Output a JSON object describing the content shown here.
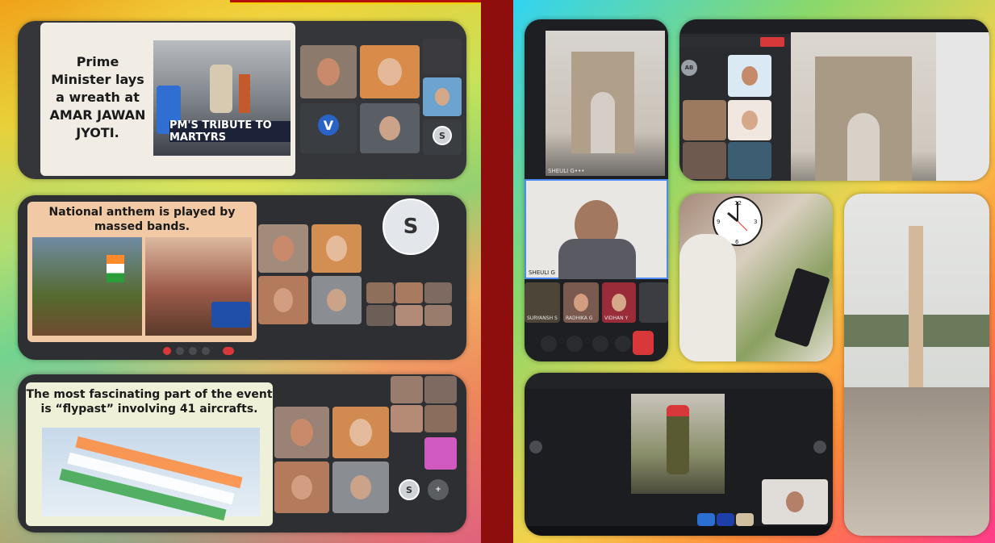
{
  "left": {
    "slide1": {
      "title": "Prime Minister lays a wreath at AMAR JAWAN JYOTI.",
      "banner": "PM'S TRIBUTE TO MARTYRS",
      "avatar_v": "V",
      "avatar_s": "S"
    },
    "slide2": {
      "title": "National anthem is played by massed bands.",
      "avatar_s": "S"
    },
    "slide3": {
      "title": "The most fascinating part of the event is “flypast” involving 41 aircrafts.",
      "avatar_s": "S"
    }
  },
  "right": {
    "tile_a": {
      "name": "SHEULI G",
      "more": "•••"
    },
    "tile_b": {
      "name": "SHEULI G"
    },
    "participants": [
      {
        "name": "SURYANSH S"
      },
      {
        "name": "RADHIKA G"
      },
      {
        "name": "VIDHAN Y"
      }
    ],
    "tile_c": {
      "avatar": "AB"
    },
    "clock": {
      "hour": 10,
      "minute": 45
    }
  },
  "colors": {
    "left_border": "#f1a21b",
    "divider": "#8e0d0d",
    "end_call": "#d9383a",
    "slide_bg": "#efe9d4"
  }
}
